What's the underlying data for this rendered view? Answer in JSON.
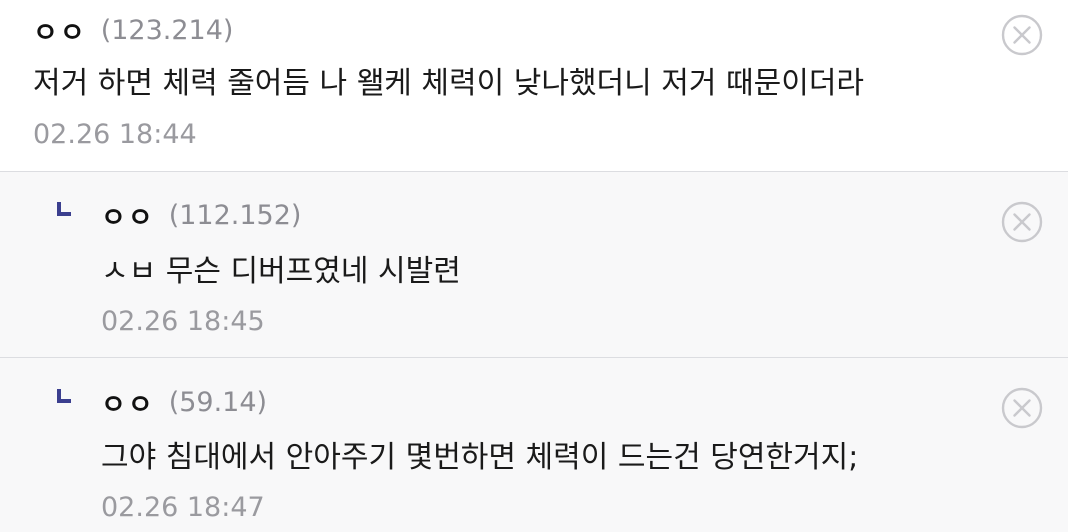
{
  "colors": {
    "reply_marker": "#3b3f8f",
    "delete_icon": "#c9c9cd",
    "ip_text": "#8d8d93",
    "date_text": "#9a9a9f",
    "reply_background": "#f8f8f9"
  },
  "comments": [
    {
      "nickname": "ㅇㅇ",
      "ip": "(123.214)",
      "text": "저거 하면 체력 줄어듬 나 왤케 체력이 낮나했더니 저거 때문이더라",
      "date": "02.26 18:44",
      "is_reply": false,
      "delete_icon": "delete-icon"
    },
    {
      "nickname": "ㅇㅇ",
      "ip": "(112.152)",
      "text": "ㅅㅂ 무슨 디버프였네 시발련",
      "date": "02.26 18:45",
      "is_reply": true,
      "reply_icon": "reply-arrow-icon",
      "delete_icon": "delete-icon"
    },
    {
      "nickname": "ㅇㅇ",
      "ip": "(59.14)",
      "text": "그야 침대에서 안아주기 몇번하면 체력이 드는건 당연한거지;",
      "date": "02.26 18:47",
      "is_reply": true,
      "reply_icon": "reply-arrow-icon",
      "delete_icon": "delete-icon"
    }
  ]
}
